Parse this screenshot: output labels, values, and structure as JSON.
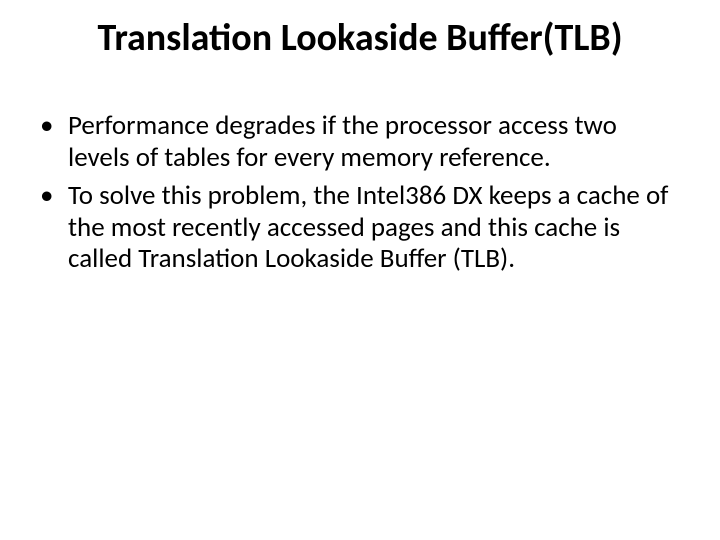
{
  "title": "Translation Lookaside Buffer(TLB)",
  "bullets": [
    "Performance degrades if the processor access two levels of tables for every memory reference.",
    "To solve this problem, the Intel386 DX keeps a cache of the most recently accessed pages and this cache is called Translation Lookaside Buffer (TLB)."
  ]
}
